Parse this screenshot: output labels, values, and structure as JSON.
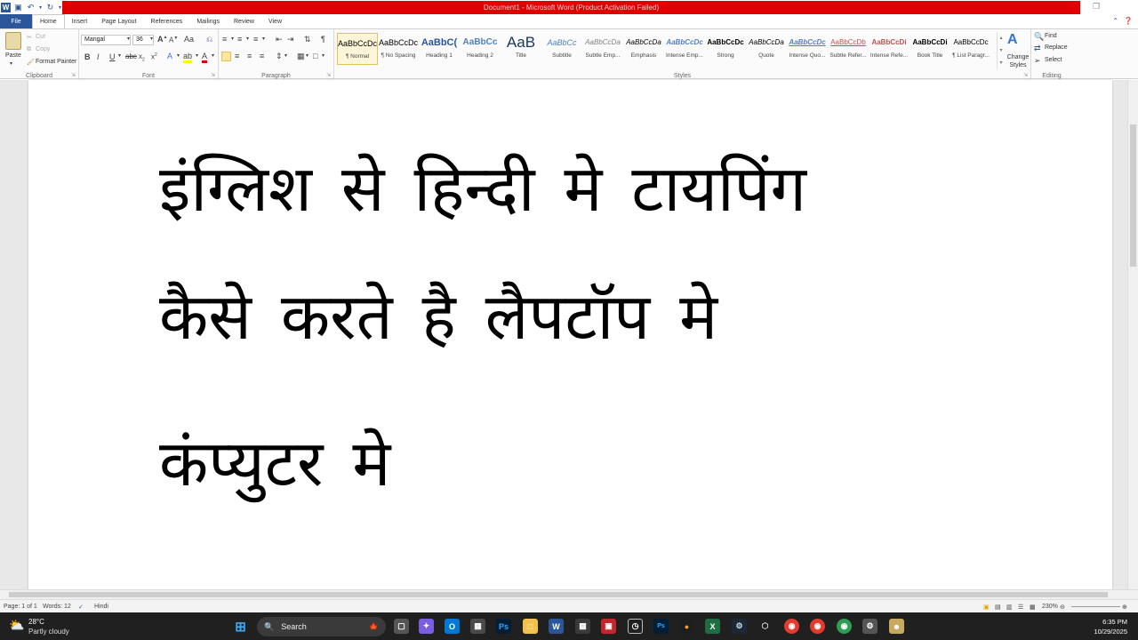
{
  "window": {
    "title": "Document1 - Microsoft Word (Product Activation Failed)",
    "colors": {
      "title_bar": "#e00000",
      "word_blue": "#2b579a"
    }
  },
  "tabs": [
    "File",
    "Home",
    "Insert",
    "Page Layout",
    "References",
    "Mailings",
    "Review",
    "View"
  ],
  "clipboard": {
    "paste": "Paste",
    "cut": "Cut",
    "copy": "Copy",
    "format_painter": "Format Painter",
    "label": "Clipboard"
  },
  "font": {
    "family": "Mangal",
    "size": "36",
    "label": "Font"
  },
  "paragraph": {
    "label": "Paragraph"
  },
  "styles": {
    "label": "Styles",
    "items": [
      {
        "sample": "AaBbCcDc",
        "name": "¶ Normal"
      },
      {
        "sample": "AaBbCcDc",
        "name": "¶ No Spacing"
      },
      {
        "sample": "AaBbC(",
        "name": "Heading 1"
      },
      {
        "sample": "AaBbCc",
        "name": "Heading 2"
      },
      {
        "sample": "AaB",
        "name": "Title"
      },
      {
        "sample": "AaBbCc",
        "name": "Subtitle"
      },
      {
        "sample": "AaBbCcDa",
        "name": "Subtle Emp..."
      },
      {
        "sample": "AaBbCcDa",
        "name": "Emphasis"
      },
      {
        "sample": "AaBbCcDc",
        "name": "Intense Emp..."
      },
      {
        "sample": "AaBbCcDc",
        "name": "Strong"
      },
      {
        "sample": "AaBbCcDa",
        "name": "Quote"
      },
      {
        "sample": "AaBbCcDc",
        "name": "Intense Quo..."
      },
      {
        "sample": "AaBbCcDb",
        "name": "Subtle Refer..."
      },
      {
        "sample": "AaBbCcDi",
        "name": "Intense Refe..."
      },
      {
        "sample": "AaBbCcDi",
        "name": "Book Title"
      },
      {
        "sample": "AaBbCcDc",
        "name": "¶ List Paragr..."
      }
    ],
    "change_styles": "Change Styles"
  },
  "editing": {
    "find": "Find",
    "replace": "Replace",
    "select": "Select",
    "label": "Editing"
  },
  "document": {
    "lines": [
      "इंग्लिश से हिन्दी मे टायपिंग",
      "कैसे करते है लैपटॉप मे",
      "कंप्युटर मे"
    ]
  },
  "statusbar": {
    "page": "Page: 1 of 1",
    "words": "Words: 12",
    "language": "Hindi",
    "zoom": "230%"
  },
  "taskbar": {
    "temperature": "28°C",
    "weather": "Partly cloudy",
    "search": "Search",
    "time": "6:35 PM",
    "date": "10/29/2025"
  }
}
